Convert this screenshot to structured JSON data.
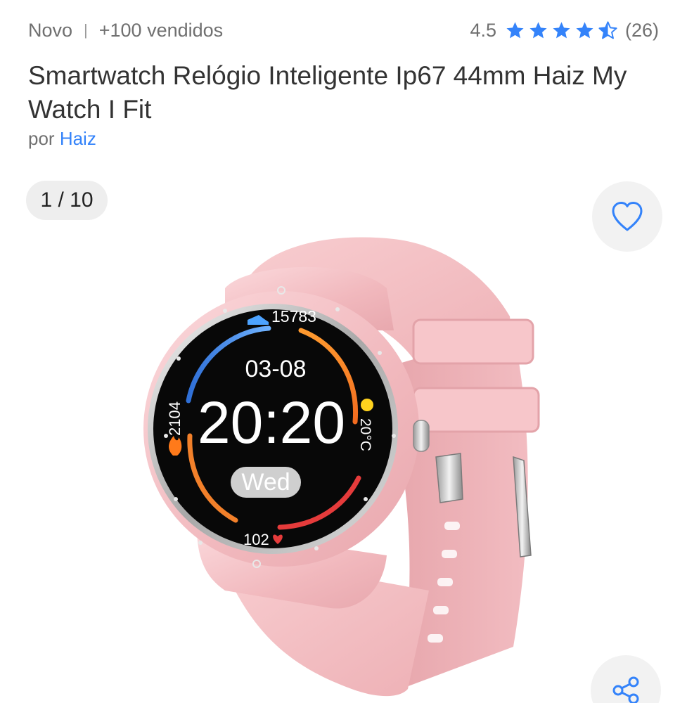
{
  "header": {
    "condition": "Novo",
    "separator": "|",
    "sold": "+100 vendidos",
    "rating": {
      "score": "4.5",
      "value": 4.5,
      "max": 5,
      "count": "(26)"
    }
  },
  "product": {
    "title": "Smartwatch Relógio Inteligente Ip67 44mm Haiz My Watch I Fit",
    "seller_prefix": "por",
    "seller_name": "Haiz"
  },
  "gallery": {
    "counter": "1 / 10",
    "current": 1,
    "total": 10
  },
  "watch_face": {
    "steps": "15783",
    "date": "03-08",
    "time": "20:20",
    "day": "Wed",
    "calories": "2104",
    "temperature": "20°C",
    "heart_rate": "102"
  },
  "icons": {
    "favorite": "heart-icon",
    "share": "share-icon",
    "star": "star-icon"
  },
  "colors": {
    "accent": "#3483fa",
    "watch_pink": "#f4c0c4",
    "text_primary": "#333333",
    "text_secondary": "#707070"
  }
}
